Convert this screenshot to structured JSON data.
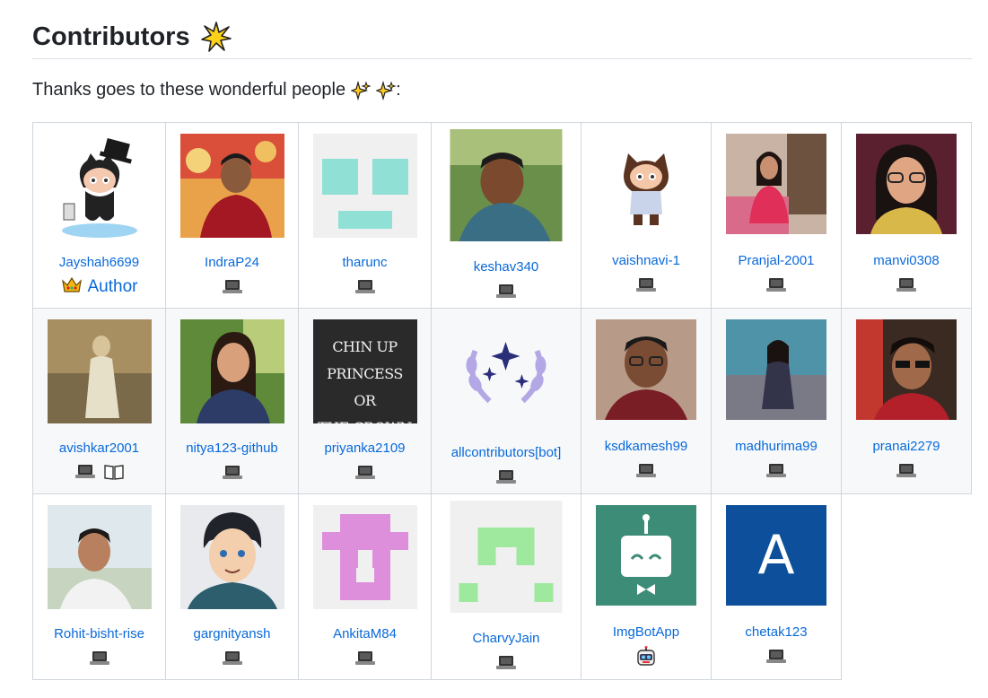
{
  "heading": {
    "title": "Contributors",
    "icon": "sparkle-star-icon"
  },
  "intro": {
    "text": "Thanks goes to these wonderful people",
    "suffix": ":"
  },
  "contributors": [
    {
      "login": "Jayshah6699",
      "badge": "Author"
    },
    {
      "login": "IndraP24"
    },
    {
      "login": "tharunc"
    },
    {
      "login": "keshav340"
    },
    {
      "login": "vaishnavi-1"
    },
    {
      "login": "Pranjal-2001"
    },
    {
      "login": "manvi0308"
    },
    {
      "login": "avishkar2001"
    },
    {
      "login": "nitya123-github"
    },
    {
      "login": "priyanka2109",
      "avatar_text": [
        "CHIN UP PRINCESS",
        "OR",
        "THE CROWN SLIPS."
      ]
    },
    {
      "login": "allcontributors[bot]"
    },
    {
      "login": "ksdkamesh99"
    },
    {
      "login": "madhurima99"
    },
    {
      "login": "pranai2279"
    },
    {
      "login": "Rohit-bisht-rise"
    },
    {
      "login": "gargnityansh"
    },
    {
      "login": "AnkitaM84"
    },
    {
      "login": "CharvyJain"
    },
    {
      "login": "ImgBotApp"
    },
    {
      "login": "chetak123",
      "avatar_text": "A"
    }
  ],
  "colors": {
    "link": "#0969da",
    "border": "#d0d7de",
    "alt_row": "#f6f8fa"
  }
}
